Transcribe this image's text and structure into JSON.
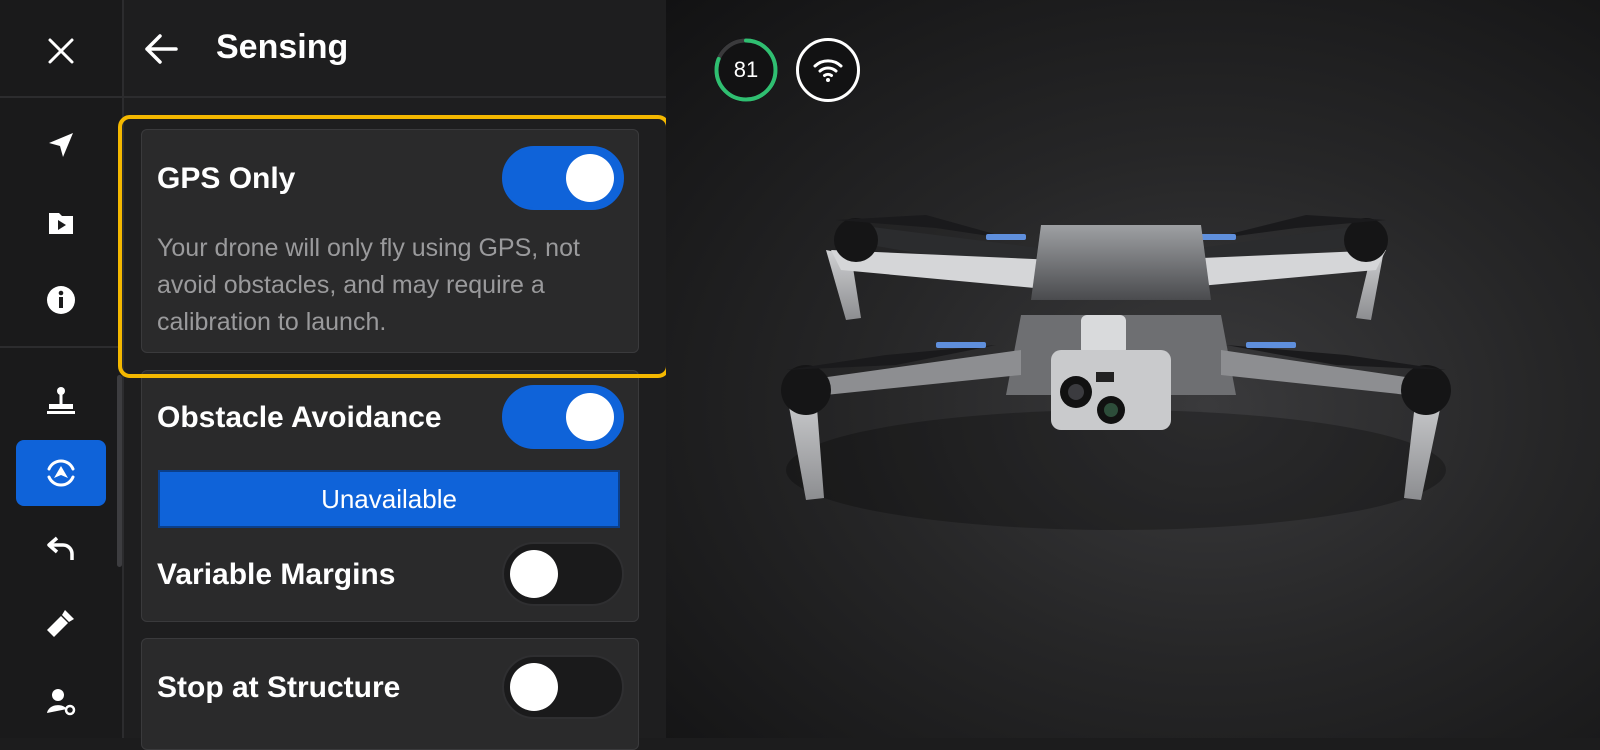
{
  "panel": {
    "title": "Sensing"
  },
  "settings": [
    {
      "label": "GPS Only",
      "on": true,
      "description": "Your drone will only fly using GPS, not avoid obstacles, and may require a calibration to launch."
    },
    {
      "label": "Obstacle Avoidance",
      "on": true,
      "status": "Unavailable"
    },
    {
      "label": "Variable Margins",
      "on": false
    },
    {
      "label": "Stop at Structure",
      "on": false
    }
  ],
  "status": {
    "battery": "81",
    "battery_level": 0.81
  },
  "colors": {
    "accent": "#0f63d9",
    "highlight": "#f4b800",
    "battery_ring": "#2fbf71"
  },
  "icons": [
    "close-icon",
    "navigation-arrow-icon",
    "media-folder-icon",
    "info-icon",
    "landing-pad-icon",
    "obstacle-sensing-icon",
    "return-icon",
    "flashlight-icon",
    "user-settings-icon",
    "back-arrow-icon",
    "wifi-icon"
  ]
}
